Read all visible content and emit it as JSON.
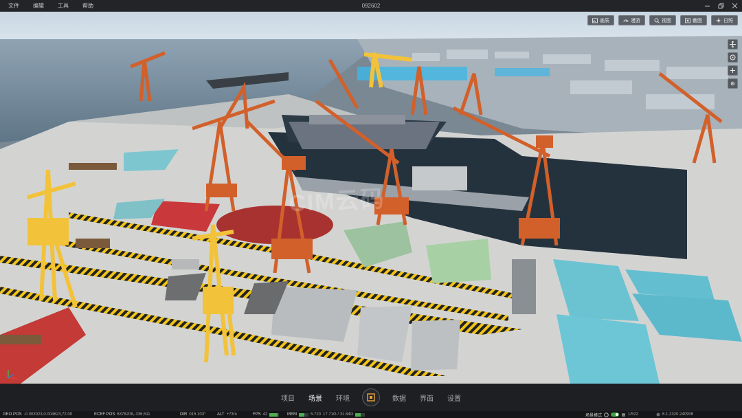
{
  "menu": [
    "文件",
    "编辑",
    "工具",
    "帮助"
  ],
  "window_title": "092602",
  "top_tools": [
    {
      "label": "画质",
      "icon": "image-icon"
    },
    {
      "label": "漫游",
      "icon": "speed-icon"
    },
    {
      "label": "视图",
      "icon": "view-icon"
    },
    {
      "label": "截图",
      "icon": "screenshot-icon"
    },
    {
      "label": "日照",
      "icon": "sun-icon"
    }
  ],
  "side_tools": [
    "move-icon",
    "orbit-icon",
    "zoom-icon",
    "settings-icon"
  ],
  "watermark": "CIM云码",
  "nav": {
    "left_tabs": [
      "项目",
      "场景",
      "环境"
    ],
    "right_tabs": [
      "数据",
      "界面",
      "设置"
    ],
    "active": "场景"
  },
  "status": {
    "geo_pos_label": "GEO POS",
    "geo_pos_value": "-0.003023,0.004623,72.00",
    "ecef_pos_label": "ECEF POS",
    "ecef_pos_value": "6378208,-336,511",
    "dir_label": "DIR",
    "dir_value": "015.103°",
    "alt_label": "ALT",
    "alt_value": "+73m",
    "fps_label": "FPS",
    "fps_value": "42",
    "mem_label": "MEM",
    "mem_value": "5.720",
    "gpu_value": "17.71G / 31.84G",
    "mode_label": "场景模式",
    "page_value": "1/522",
    "version": "6.1.2320.240906"
  },
  "colors": {
    "accent": "#e8a23c",
    "crane_orange": "#d2602a",
    "crane_yellow": "#f2c23a",
    "water": "#22303c"
  }
}
